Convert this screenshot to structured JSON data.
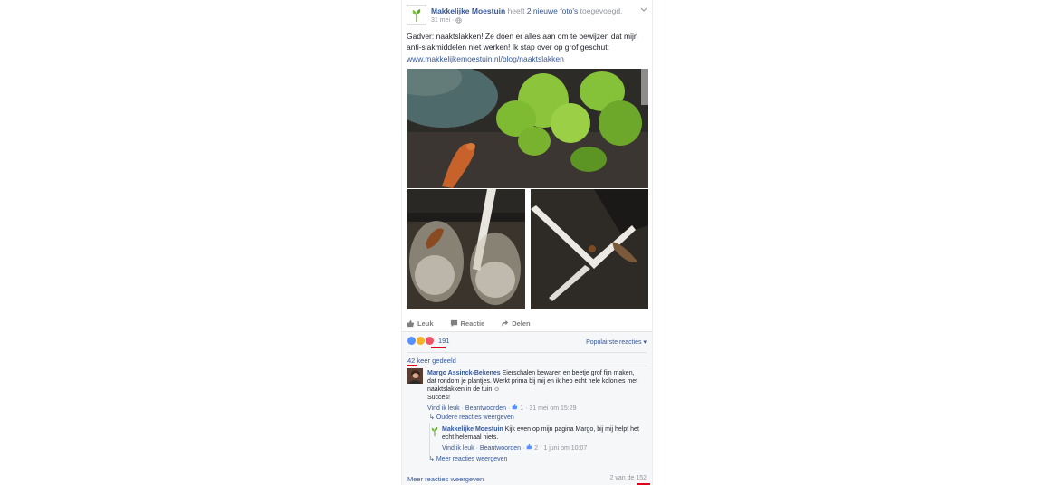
{
  "post": {
    "page_name": "Makkelijke Moestuin",
    "head_mid": " heeft ",
    "head_photos": "2 nieuwe foto's",
    "head_end": " toegevoegd.",
    "date": "31 mei ·",
    "text": "Gadver: naaktslakken! Ze doen er alles aan om te bewijzen dat mijn anti-slakmiddelen niet werken! Ik stap over op grof geschut:",
    "link": "www.makkelijkemoestuin.nl/blog/naaktslakken"
  },
  "actions": {
    "like": "Leuk",
    "comment": "Reactie",
    "share": "Delen"
  },
  "reactions": {
    "count": "191",
    "sort": "Populairste reacties ▾",
    "shares": "42 keer gedeeld",
    "accent": "#e0001b"
  },
  "comments": [
    {
      "name": "Margo Assinck-Bekenes",
      "text": " Eierschalen bewaren en beetje grof fijn maken, dat rondom je plantjes. Werkt prima bij mij en ik heb echt hele kolonies met naaktslakken in de tuin ☺",
      "text2": "Succes!",
      "like": "Vind ik leuk",
      "reply": "Beantwoorden",
      "likes": "1",
      "time": "· 31 mei om 15:29"
    },
    {
      "older": "Oudere reacties weergeven"
    },
    {
      "name": "Makkelijke Moestuin",
      "text": " Kijk even op mijn pagina Margo, bij mij helpt het echt helemaal niets.",
      "like": "Vind ik leuk",
      "reply": "Beantwoorden",
      "likes": "2",
      "time": "· 1 juni om 10:07"
    }
  ],
  "more_replies": "Meer reacties weergeven",
  "footer": {
    "more_comments": "Meer reacties weergeven",
    "paging_prefix": "2 van de ",
    "paging_total": "152"
  }
}
